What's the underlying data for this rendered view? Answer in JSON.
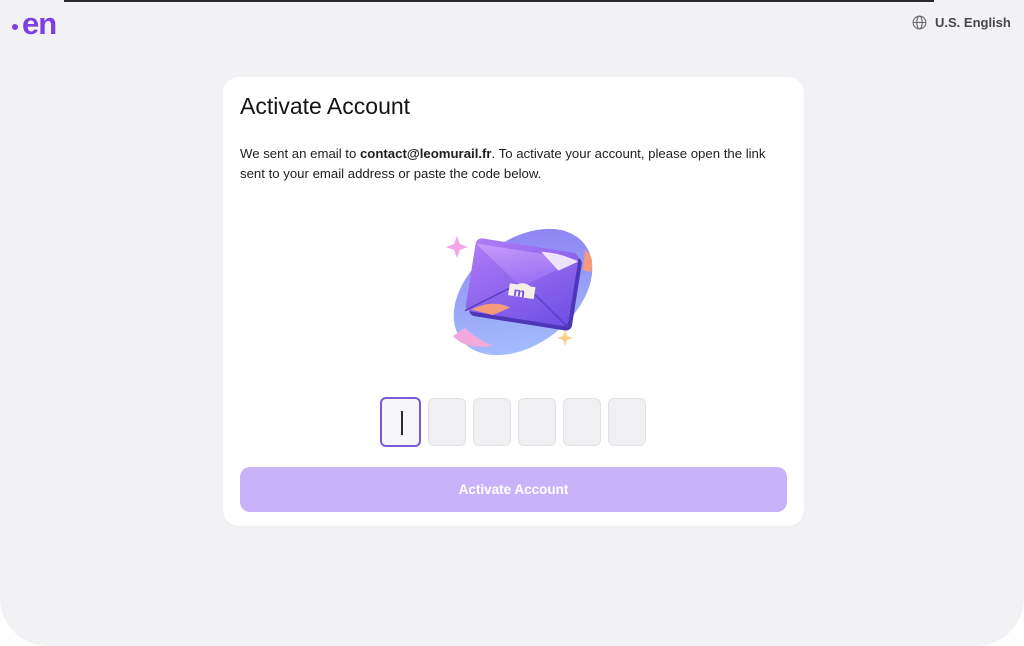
{
  "brand": {
    "logo_text": "en",
    "accent_color": "#7b3fe4"
  },
  "header": {
    "language_label": "U.S. English",
    "language_icon": "globe-icon"
  },
  "card": {
    "title": "Activate Account",
    "message_prefix": "We sent an email to ",
    "email": "contact@leomurail.fr",
    "message_suffix": ". To activate your account, please open the link sent to your email address or paste the code below.",
    "illustration": "envelope-illustration",
    "code_inputs": [
      "",
      "",
      "",
      "",
      "",
      ""
    ],
    "submit_label": "Activate Account",
    "submit_color": "#c8b3fb"
  }
}
